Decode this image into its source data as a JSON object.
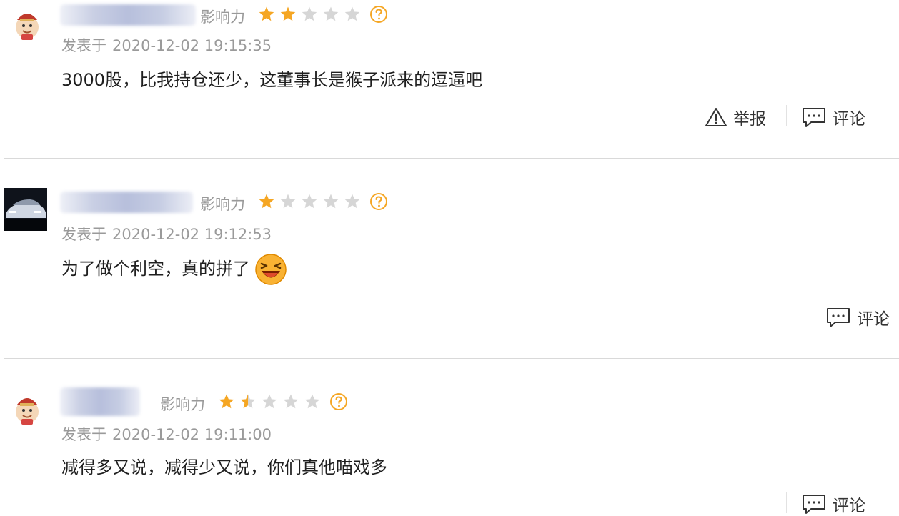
{
  "comments": [
    {
      "influence_label": "影响力",
      "rating": 2,
      "time_label": "发表于",
      "time": "2020-12-02 19:15:35",
      "text": "3000股，比我持仓还少，这董事长是猴子派来的逗逼吧",
      "report_label": "举报",
      "comment_label": "评论"
    },
    {
      "influence_label": "影响力",
      "rating": 1,
      "time_label": "发表于",
      "time": "2020-12-02 19:12:53",
      "text": "为了做个利空，真的拼了",
      "emoji": "laughing-emoji",
      "comment_label": "评论"
    },
    {
      "influence_label": "影响力",
      "rating": 1.5,
      "time_label": "发表于",
      "time": "2020-12-02 19:11:00",
      "text": "减得多又说，减得少又说，你们真他喵戏多",
      "comment_label": "评论"
    }
  ],
  "colors": {
    "star_filled": "#f5a623",
    "star_empty": "#d6d6d6",
    "help_icon": "#f5a623",
    "divider": "#d9d9d9"
  },
  "icons": [
    "warning-icon",
    "comment-bubble-icon",
    "help-icon",
    "star-icon"
  ]
}
